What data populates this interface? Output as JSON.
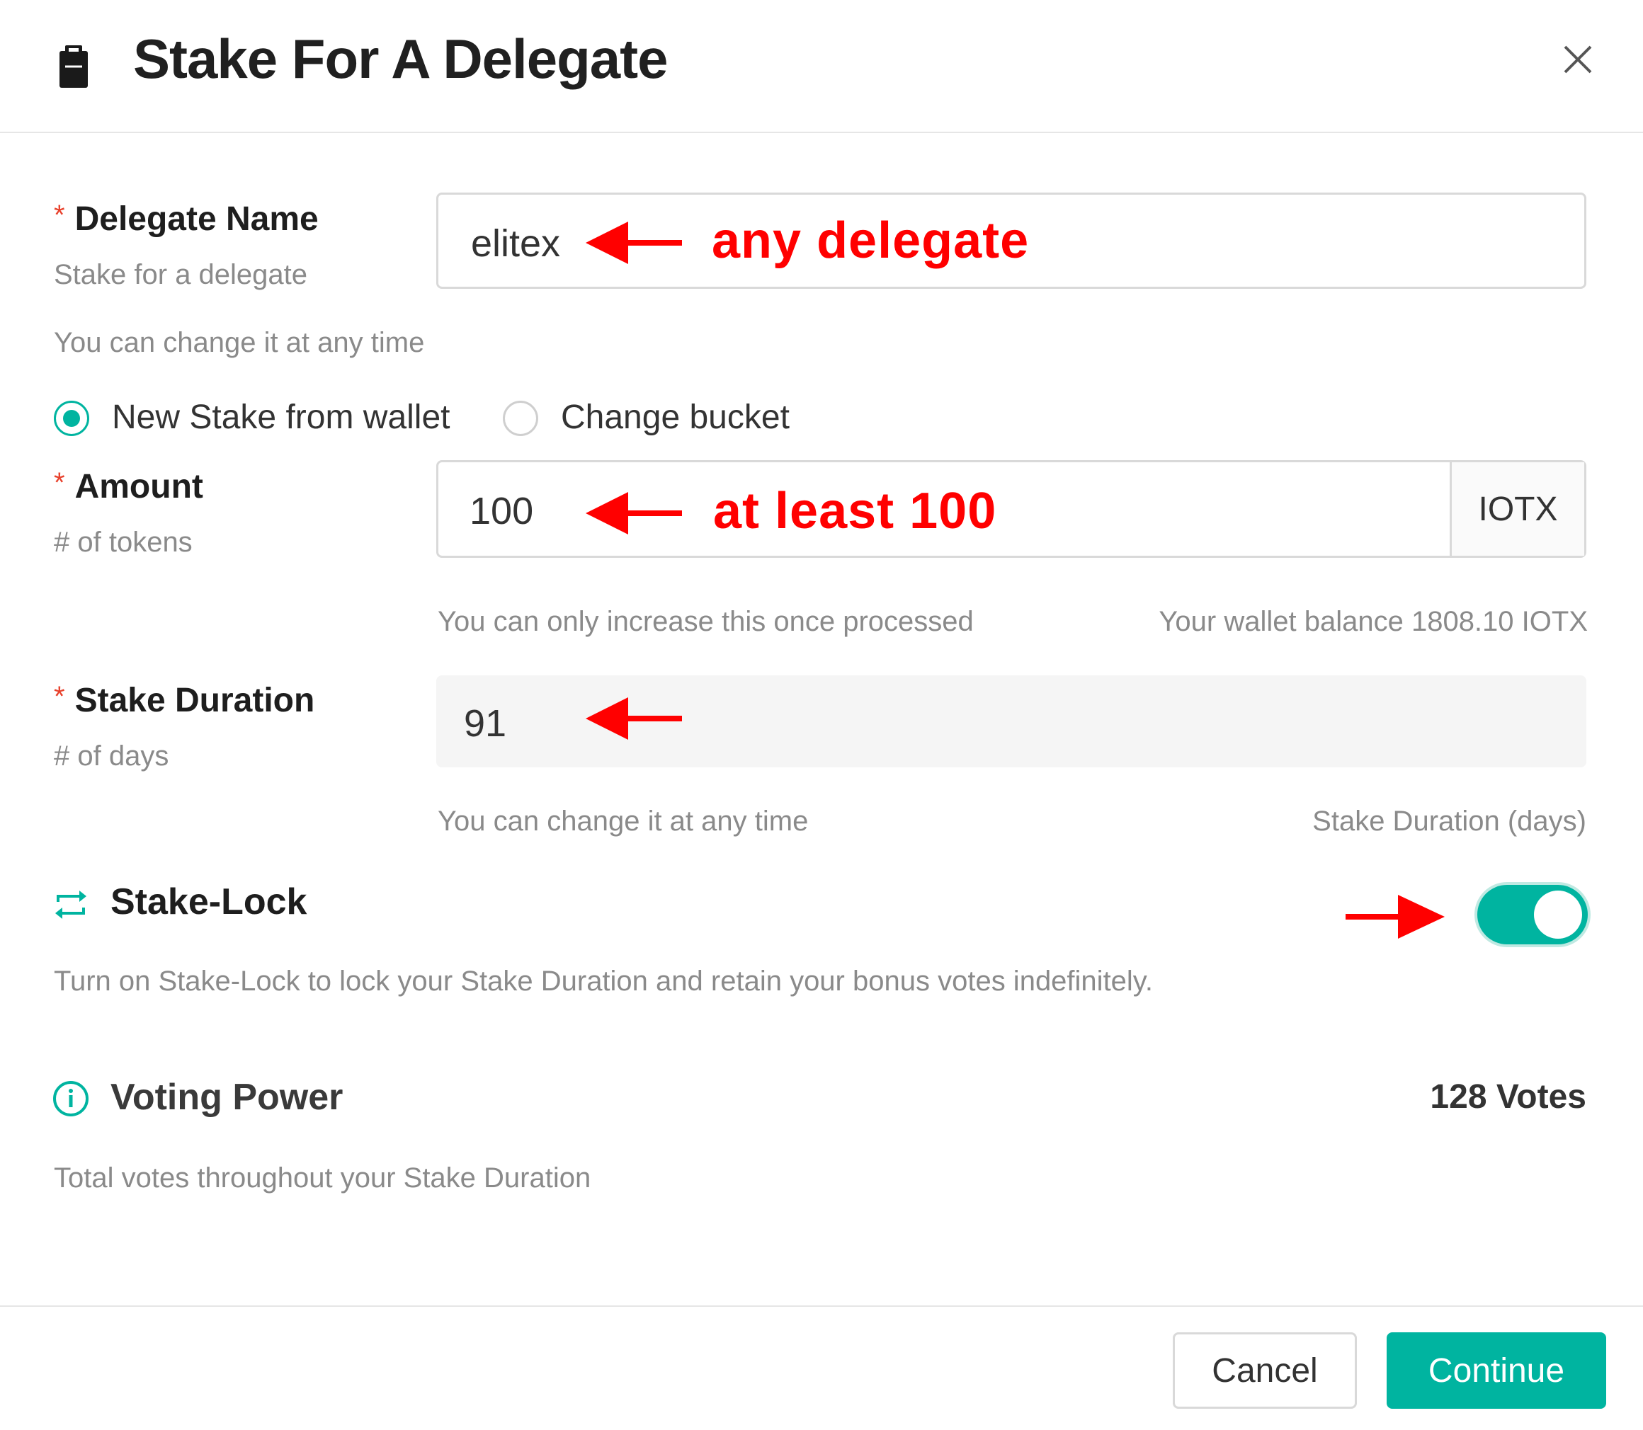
{
  "dialog": {
    "title": "Stake For A Delegate",
    "icons": {
      "title_icon": "document-clipboard-icon",
      "close_icon": "close-icon"
    }
  },
  "delegate": {
    "required_mark": "*",
    "label": "Delegate Name",
    "sublabel": "Stake for a delegate",
    "value": "elitex",
    "annotation": "any delegate",
    "hint": "You can change it at any time"
  },
  "stake_source": {
    "options": [
      {
        "label": "New Stake from wallet",
        "selected": true
      },
      {
        "label": "Change bucket",
        "selected": false
      }
    ]
  },
  "amount": {
    "required_mark": "*",
    "label": "Amount",
    "sublabel": "# of tokens",
    "value": "100",
    "unit": "IOTX",
    "annotation": "at least 100",
    "hint_left": "You can only increase this once processed",
    "hint_right": "Your wallet balance 1808.10 IOTX"
  },
  "duration": {
    "required_mark": "*",
    "label": "Stake Duration",
    "sublabel": "# of days",
    "value": "91",
    "hint_left": "You can change it at any time",
    "hint_right": "Stake Duration (days)"
  },
  "stake_lock": {
    "title": "Stake-Lock",
    "icon": "repeat-icon",
    "enabled": true,
    "description": "Turn on Stake-Lock to lock your Stake Duration and retain your bonus votes indefinitely."
  },
  "voting_power": {
    "title": "Voting Power",
    "icon": "info-circle-icon",
    "value": "128 Votes",
    "description": "Total votes throughout your Stake Duration"
  },
  "footer": {
    "cancel_label": "Cancel",
    "continue_label": "Continue"
  },
  "colors": {
    "accent": "#00b4a0",
    "annotation": "#ff0000",
    "required": "#e8412c"
  }
}
